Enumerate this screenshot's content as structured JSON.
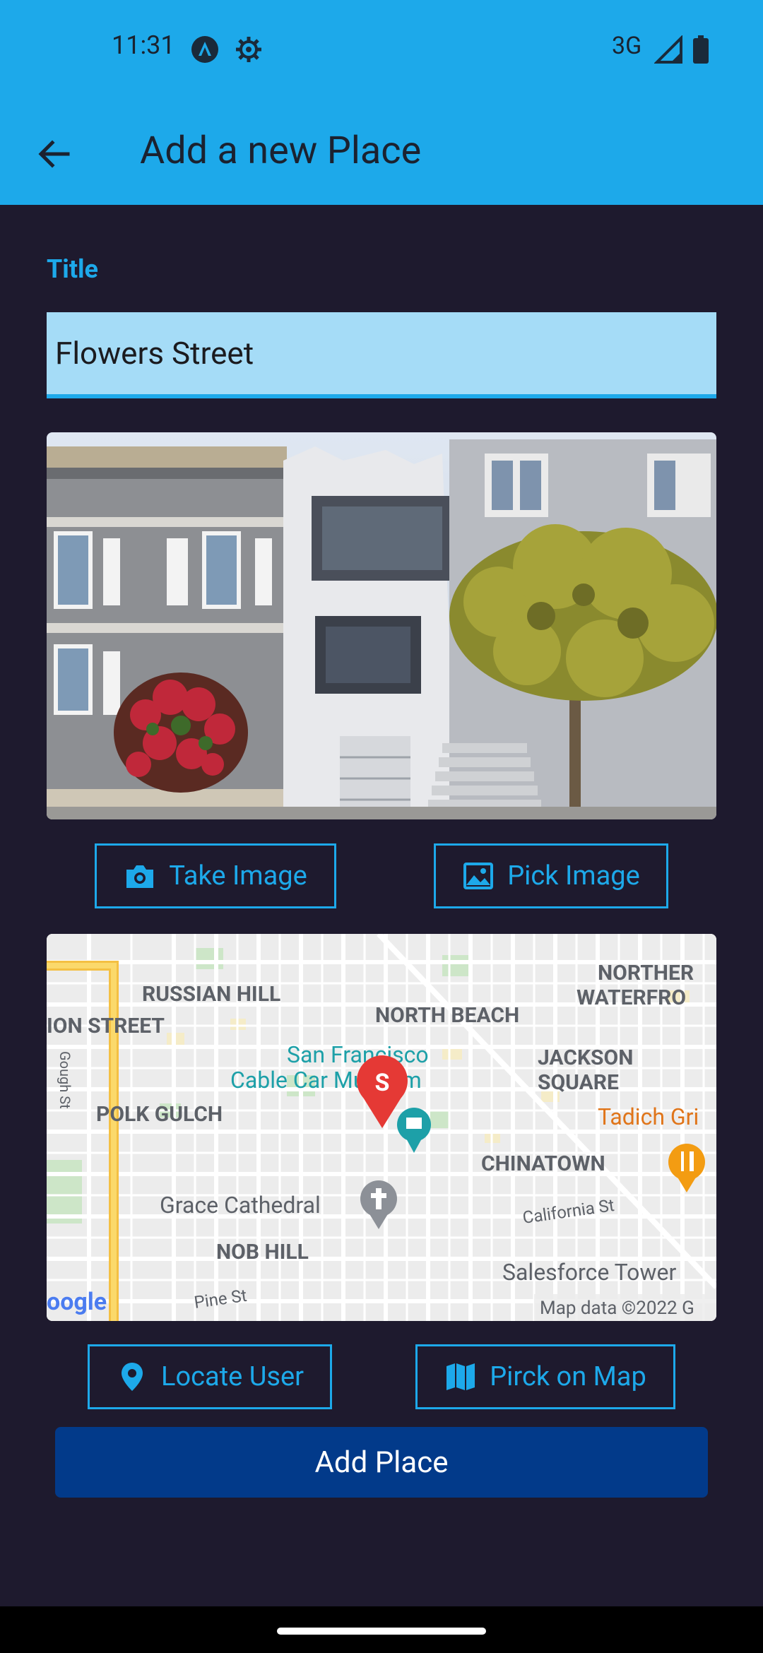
{
  "status_bar": {
    "time": "11:31",
    "network": "3G",
    "icons": [
      "react-native-icon",
      "settings-gear-icon",
      "signal-icon",
      "battery-icon"
    ]
  },
  "app_bar": {
    "title": "Add a new Place",
    "back_icon": "arrow-back-icon",
    "background": "#1da9ea"
  },
  "form": {
    "title_label": "Title",
    "title_value": "Flowers Street",
    "image_alt": "Photo of Victorian houses with a red flowering bush and a tree",
    "take_image_label": "Take Image",
    "pick_image_label": "Pick Image",
    "locate_user_label": "Locate User",
    "pick_on_map_label": "Pirck on Map",
    "add_place_label": "Add Place"
  },
  "map": {
    "labels": {
      "russian_hill": "RUSSIAN HILL",
      "north_beach": "NORTH BEACH",
      "northern_waterfront": "NORTHER",
      "northern_waterfront2": "WATERFRO",
      "union_street": "ION STREET",
      "gough": "Gough St",
      "sf": "San Francisco",
      "cable_car": "Cable Car Museum",
      "jackson": "JACKSON",
      "square": "SQUARE",
      "tadich": "Tadich Gri",
      "polk_gulch": "POLK GULCH",
      "chinatown": "CHINATOWN",
      "california_st": "California St",
      "grace": "Grace Cathedral",
      "nob_hill": "NOB HILL",
      "salesforce": "Salesforce Tower",
      "pine_st": "Pine St",
      "google": "oogle",
      "attribution": "Map data ©2022 G",
      "marker_letter": "S"
    }
  },
  "colors": {
    "accent": "#1da9ea",
    "background": "#1e1a2e",
    "primary_button": "#023a8a",
    "field_fill": "#a5dcf7"
  }
}
